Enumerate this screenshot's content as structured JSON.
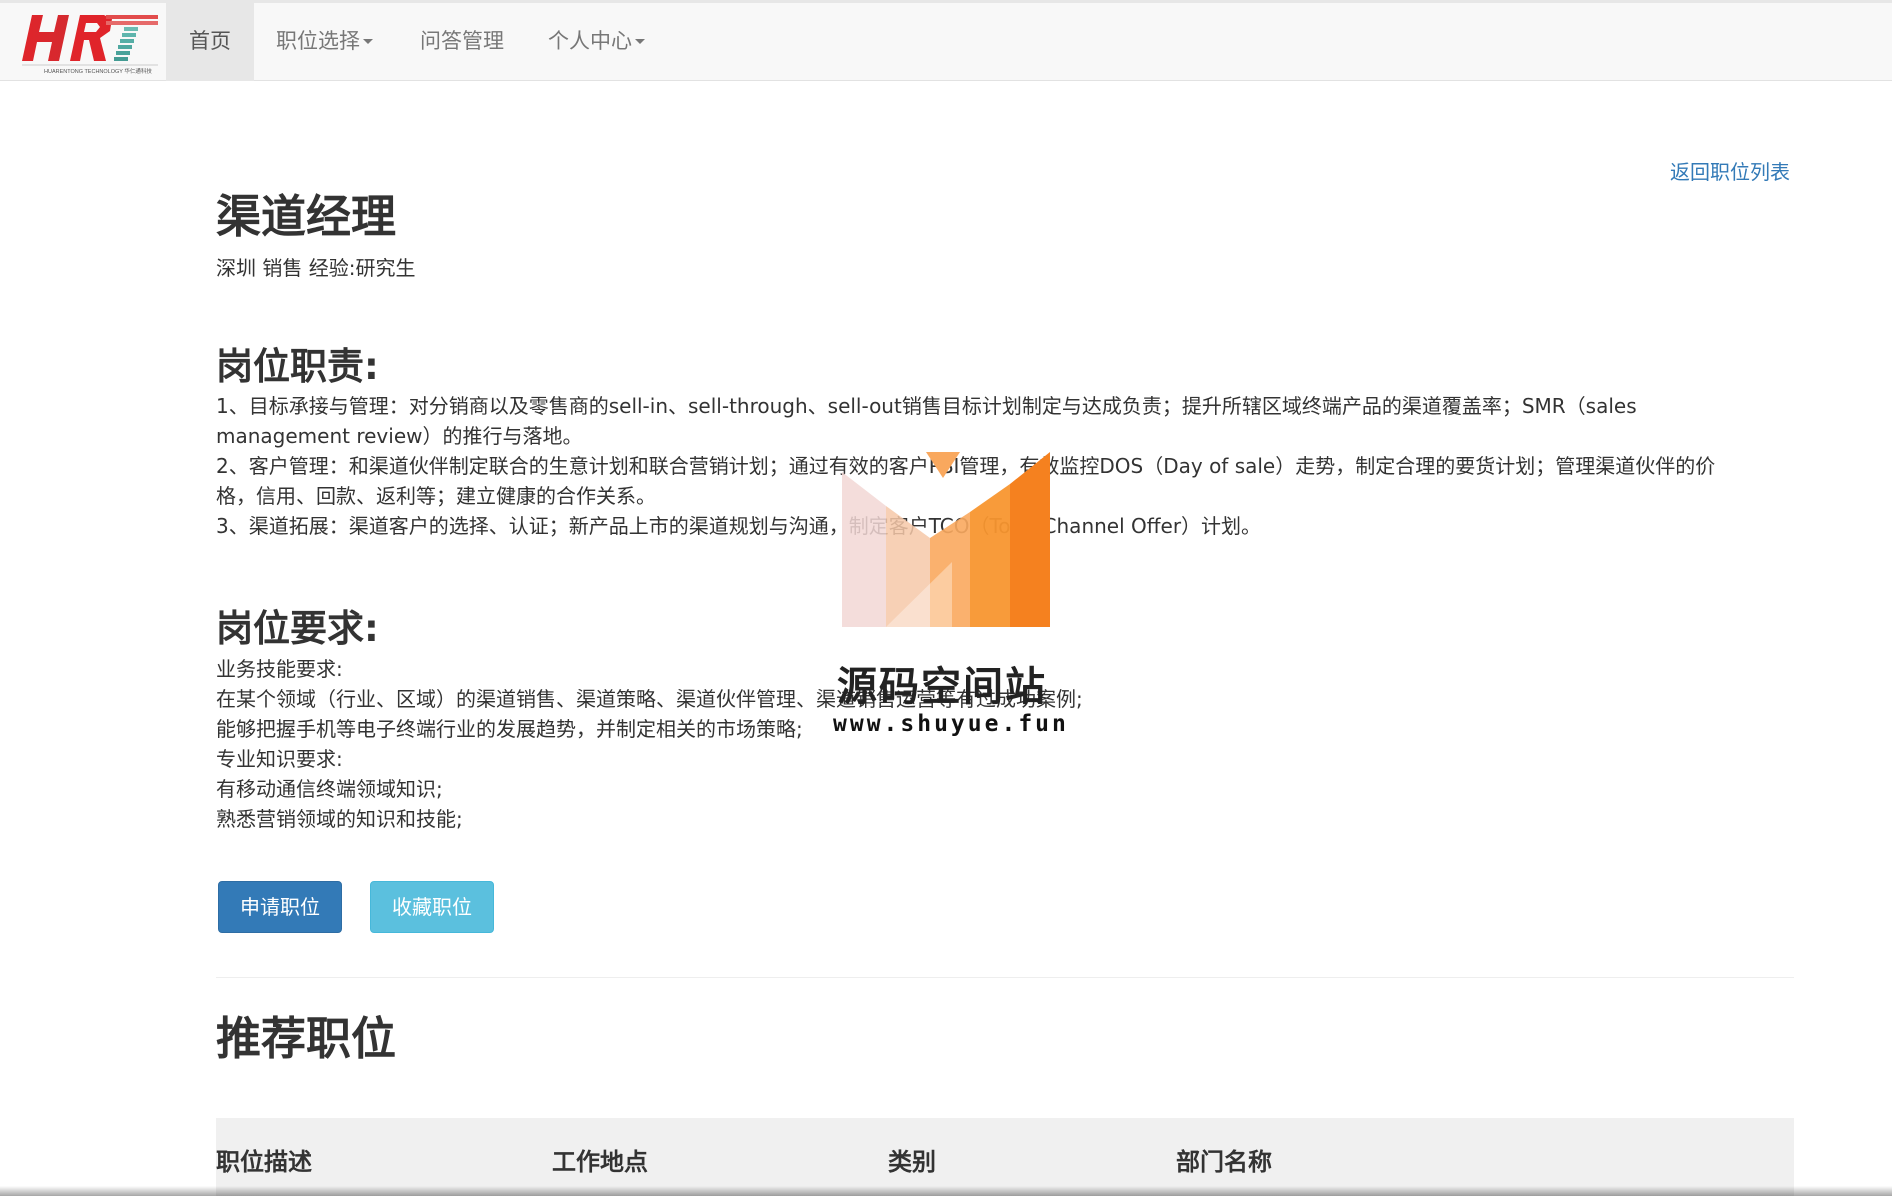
{
  "navbar": {
    "brand_text": "HRT",
    "brand_subtext": "HUARENTONG TECHNOLOGY 华仁通科技",
    "items": [
      {
        "label": "首页",
        "active": true,
        "has_dropdown": false
      },
      {
        "label": "职位选择",
        "active": false,
        "has_dropdown": true
      },
      {
        "label": "问答管理",
        "active": false,
        "has_dropdown": false
      },
      {
        "label": "个人中心",
        "active": false,
        "has_dropdown": true
      }
    ]
  },
  "job": {
    "back_link": "返回职位列表",
    "title": "渠道经理",
    "meta": "深圳 销售 经验:研究生",
    "duties_heading": "岗位职责:",
    "duties_lines": [
      "1、目标承接与管理：对分销商以及零售商的sell-in、sell-through、sell-out销售目标计划制定与达成负责；提升所辖区域终端产品的渠道覆盖率；SMR（sales",
      "management review）的推行与落地。",
      "2、客户管理：和渠道伙伴制定联合的生意计划和联合营销计划；通过有效的客户PSI管理，有效监控DOS（Day of sale）走势，制定合理的要货计划；管理渠道伙伴的价",
      "格，信用、回款、返利等；建立健康的合作关系。",
      "3、渠道拓展：渠道客户的选择、认证；新产品上市的渠道规划与沟通，制定客户TCO（Total Channel Offer）计划。"
    ],
    "requirements_heading": "岗位要求:",
    "requirements_lines": [
      "业务技能要求:",
      "在某个领域（行业、区域）的渠道销售、渠道策略、渠道伙伴管理、渠道销售运营等有过成功案例;",
      "能够把握手机等电子终端行业的发展趋势，并制定相关的市场策略;",
      "专业知识要求:",
      "有移动通信终端领域知识;",
      "熟悉营销领域的知识和技能;"
    ],
    "apply_button": "申请职位",
    "favorite_button": "收藏职位"
  },
  "recommended": {
    "heading": "推荐职位",
    "columns": [
      "职位描述",
      "工作地点",
      "类别",
      "部门名称"
    ]
  },
  "watermark": {
    "text": "源码空间站",
    "url": "www.shuyue.fun"
  },
  "colors": {
    "primary": "#337ab7",
    "info": "#5bc0de",
    "brand_red": "#d7262b",
    "watermark_orange": "#f5811f"
  }
}
